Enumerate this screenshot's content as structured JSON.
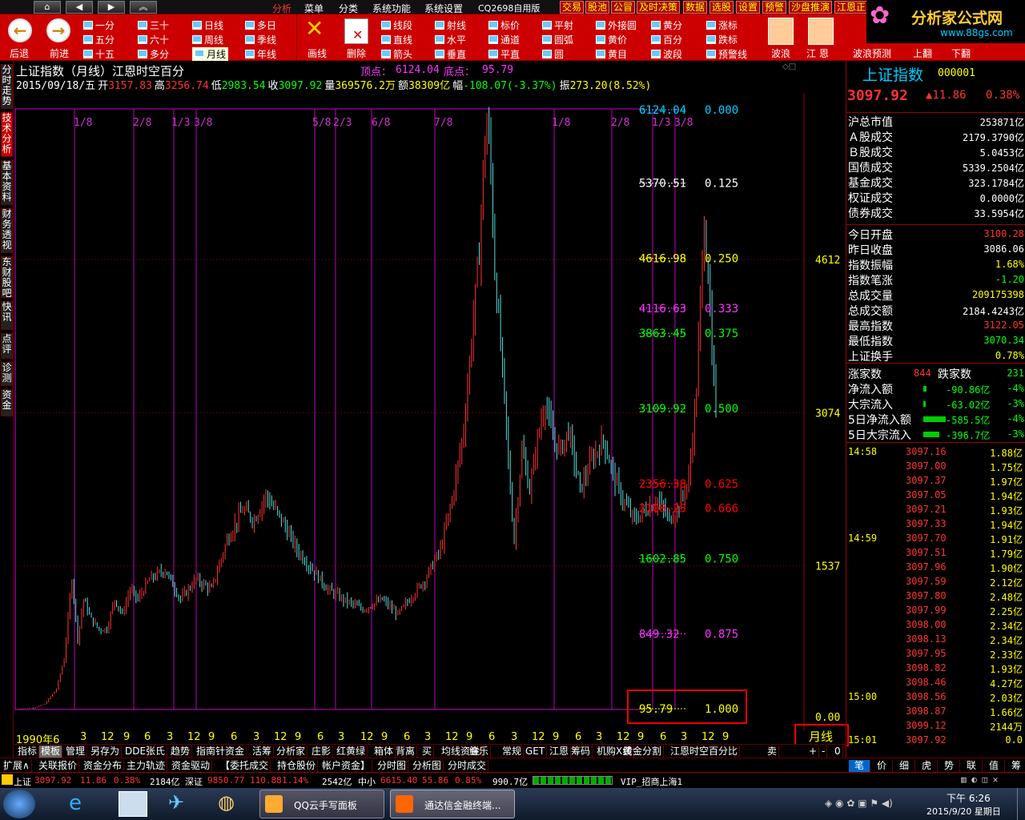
{
  "menubar": {
    "nav": [
      "⌂",
      "◀",
      "▶",
      "︽"
    ],
    "items": [
      "分析",
      "菜单",
      "分类",
      "系统功能",
      "系统设置",
      "CQ2698自用版"
    ],
    "right": [
      "交易",
      "股池",
      "公冒",
      "及时决策",
      "数据",
      "选股",
      "设置",
      "预警",
      "沙盘推演",
      "江恩正"
    ]
  },
  "toolbar": {
    "back": "后退",
    "forward": "前进",
    "periods": [
      [
        "一分",
        "三十",
        "日线",
        "多日"
      ],
      [
        "五分",
        "六十",
        "周线",
        "季线"
      ],
      [
        "十五",
        "多分",
        "月线",
        "年线"
      ]
    ],
    "draw_label": "画线",
    "delete_label": "删除",
    "tools": [
      [
        "线段",
        "射线",
        "标价",
        "平射",
        "外接圆",
        "黄分",
        "涨标"
      ],
      [
        "直线",
        "水平",
        "通道",
        "圆弧",
        "黄价",
        "百分",
        "跌标"
      ],
      [
        "箭头",
        "垂直",
        "平直",
        "圆",
        "黄目",
        "波段",
        "预警线"
      ]
    ],
    "right": [
      "波浪",
      "江 恩",
      "波浪预测",
      "上翻",
      "下翻"
    ]
  },
  "logo": {
    "title": "分析家公式网",
    "url": "www.88gs.com"
  },
  "left_tabs": [
    "分时走势",
    "技术分析",
    "基本资料",
    "财务透视",
    "东财股吧",
    "快讯",
    "点评",
    "诊测",
    "资金"
  ],
  "chart": {
    "title": "上证指数（月线）江恩时空百分",
    "top_label": "顶点：",
    "top_value": "6124.04",
    "bottom_label": "底点：",
    "bottom_value": "95.79",
    "info": [
      {
        "k": "",
        "v": "2015/09/18/五",
        "c": "#fff"
      },
      {
        "k": "开",
        "v": "3157.83",
        "c": "#f33"
      },
      {
        "k": "高",
        "v": "3256.74",
        "c": "#f33"
      },
      {
        "k": "低",
        "v": "2983.54",
        "c": "#0f0"
      },
      {
        "k": "收",
        "v": "3097.92",
        "c": "#0f0"
      },
      {
        "k": "量",
        "v": "369576.2万",
        "c": "#ff0"
      },
      {
        "k": "额",
        "v": "38309亿",
        "c": "#ff0"
      },
      {
        "k": "幅",
        "v": "-108.07(-3.37%)",
        "c": "#0f0"
      },
      {
        "k": "振",
        "v": "273.20(8.52%)",
        "c": "#ff0"
      }
    ],
    "fractions": [
      "1/8",
      "2/8",
      "1/3",
      "3/8",
      "5/8",
      "2/3",
      "6/8",
      "7/8",
      "1/8",
      "2/8",
      "1/3",
      "3/8"
    ],
    "levels": [
      {
        "price": "6124.04",
        "pct": "0.000",
        "c": "#0cf"
      },
      {
        "price": "5370.51",
        "pct": "0.125",
        "c": "#fff"
      },
      {
        "price": "4616.98",
        "pct": "0.250",
        "c": "#ff0"
      },
      {
        "price": "4116.63",
        "pct": "0.333",
        "c": "#f3f"
      },
      {
        "price": "3863.45",
        "pct": "0.375",
        "c": "#0f0"
      },
      {
        "price": "3109.92",
        "pct": "0.500",
        "c": "#0f0"
      },
      {
        "price": "2356.38",
        "pct": "0.625",
        "c": "#f00"
      },
      {
        "price": "2108.23",
        "pct": "0.666",
        "c": "#f00"
      },
      {
        "price": "1602.85",
        "pct": "0.750",
        "c": "#0f0"
      },
      {
        "price": "849.32",
        "pct": "0.875",
        "c": "#f3f"
      },
      {
        "price": "95.79",
        "pct": "1.000",
        "c": "#ff0"
      }
    ],
    "axis_labels": [
      "4612",
      "3074",
      "1537",
      "0.00"
    ],
    "period_box": "月线",
    "xaxis": [
      "1990年6",
      "3",
      "12",
      "9",
      "6",
      "3",
      "12",
      "9",
      "6",
      "3",
      "12",
      "9",
      "6",
      "3",
      "12",
      "9",
      "6",
      "3",
      "12",
      "9",
      "6",
      "3",
      "12",
      "9",
      "6",
      "3",
      "12",
      "9",
      "6",
      "3",
      "12",
      "9"
    ]
  },
  "tabs1": [
    "指标",
    "模板",
    "管理",
    "另存为",
    "DDE",
    "张氏",
    "趋势",
    "指南针资金",
    "活筹",
    "分析家",
    "庄影",
    "红黄绿",
    "箱体",
    "背离",
    "买",
    "均线资金",
    "鲜乐",
    "常规",
    "GET",
    "江恩",
    "筹码",
    "机购X线",
    "黄金分割",
    "江恩时空百分比",
    "卖"
  ],
  "tabs1_right": [
    "+",
    "-",
    "0"
  ],
  "tabs2": [
    "扩展∧",
    "关联报价",
    "资金分布",
    "主力轨迹",
    "资金驱动",
    "【委托成交",
    "持仓股份",
    "帐户资金】",
    "分时图",
    "分析图",
    "分时成交"
  ],
  "side": {
    "name": "上证指数",
    "code": "000001",
    "price": "3097.92",
    "change": "▲11.86",
    "pct": "0.38%",
    "rows": [
      {
        "k": "沪总市值",
        "v": "253871亿",
        "c": "#fff"
      },
      {
        "k": "Ａ股成交",
        "v": "2179.3790亿",
        "c": "#fff"
      },
      {
        "k": "Ｂ股成交",
        "v": "5.0453亿",
        "c": "#fff"
      },
      {
        "k": "国债成交",
        "v": "5339.2504亿",
        "c": "#fff"
      },
      {
        "k": "基金成交",
        "v": "323.1784亿",
        "c": "#fff"
      },
      {
        "k": "权证成交",
        "v": "0.0000亿",
        "c": "#fff"
      },
      {
        "k": "债券成交",
        "v": "33.5954亿",
        "c": "#fff"
      },
      {
        "k": "今日开盘",
        "v": "3100.28",
        "c": "#f33"
      },
      {
        "k": "昨日收盘",
        "v": "3086.06",
        "c": "#fff"
      },
      {
        "k": "指数振幅",
        "v": "1.68%",
        "c": "#ff0"
      },
      {
        "k": "指数笔涨",
        "v": "-1.20",
        "c": "#0f0"
      },
      {
        "k": "总成交量",
        "v": "209175398",
        "c": "#ff0"
      },
      {
        "k": "总成交额",
        "v": "2184.4243亿",
        "c": "#fff"
      },
      {
        "k": "最高指数",
        "v": "3122.05",
        "c": "#f33"
      },
      {
        "k": "最低指数",
        "v": "3070.34",
        "c": "#0f0"
      },
      {
        "k": "上证换手",
        "v": "0.78%",
        "c": "#ff0"
      }
    ],
    "breadth": {
      "up_label": "涨家数",
      "up": "844",
      "down_label": "跌家数",
      "down": "231"
    },
    "flows": [
      {
        "k": "净流入额",
        "v": "-90.86亿",
        "p": "-4%",
        "w": 4
      },
      {
        "k": "大宗流入",
        "v": "-63.02亿",
        "p": "-3%",
        "w": 3
      },
      {
        "k": "5日净流入额",
        "v": "-585.5亿",
        "p": "-4%",
        "w": 28
      },
      {
        "k": "5日大宗流入",
        "v": "-396.7亿",
        "p": "-3%",
        "w": 20
      }
    ],
    "ticks": [
      {
        "t": "14:58",
        "p": "3097.16",
        "v": "1.88亿"
      },
      {
        "t": "",
        "p": "3097.00",
        "v": "1.75亿"
      },
      {
        "t": "",
        "p": "3097.37",
        "v": "1.97亿"
      },
      {
        "t": "",
        "p": "3097.05",
        "v": "1.94亿"
      },
      {
        "t": "",
        "p": "3097.21",
        "v": "1.93亿"
      },
      {
        "t": "",
        "p": "3097.33",
        "v": "1.94亿"
      },
      {
        "t": "14:59",
        "p": "3097.70",
        "v": "1.91亿"
      },
      {
        "t": "",
        "p": "3097.51",
        "v": "1.79亿"
      },
      {
        "t": "",
        "p": "3097.96",
        "v": "1.90亿"
      },
      {
        "t": "",
        "p": "3097.59",
        "v": "2.12亿"
      },
      {
        "t": "",
        "p": "3097.80",
        "v": "2.48亿"
      },
      {
        "t": "",
        "p": "3097.99",
        "v": "2.25亿"
      },
      {
        "t": "",
        "p": "3098.00",
        "v": "2.34亿"
      },
      {
        "t": "",
        "p": "3098.13",
        "v": "2.34亿"
      },
      {
        "t": "",
        "p": "3097.95",
        "v": "2.33亿"
      },
      {
        "t": "",
        "p": "3098.82",
        "v": "1.93亿"
      },
      {
        "t": "",
        "p": "3098.46",
        "v": "4.27亿"
      },
      {
        "t": "15:00",
        "p": "3098.56",
        "v": "2.03亿"
      },
      {
        "t": "",
        "p": "3098.87",
        "v": "1.66亿"
      },
      {
        "t": "",
        "p": "3099.12",
        "v": "2144万"
      },
      {
        "t": "15:01",
        "p": "3097.92",
        "v": "0.0"
      }
    ],
    "tabs": [
      "笔",
      "价",
      "细",
      "虎",
      "势",
      "联",
      "值",
      "筹"
    ]
  },
  "status": {
    "sh_label": "上证",
    "sh": "3097.92",
    "sh_chg": "11.86",
    "sh_pct": "0.38%",
    "sh_amt": "2184亿",
    "sz_label": "深证",
    "sz": "9850.77",
    "sz_chg": "110.88",
    "sz_pct": "1.14%",
    "sz_amt": "2542亿",
    "zx_label": "中小",
    "zx": "6615.40",
    "zx_chg": "55.86",
    "zx_pct": "0.85%",
    "zx_amt": "990.7亿",
    "vip": "VIP_招商上海1"
  },
  "taskbar": {
    "apps": [
      "QQ云手写面板",
      "通达信金融终端..."
    ],
    "time": "下午 6:26",
    "date": "2015/9/20 星期日"
  }
}
